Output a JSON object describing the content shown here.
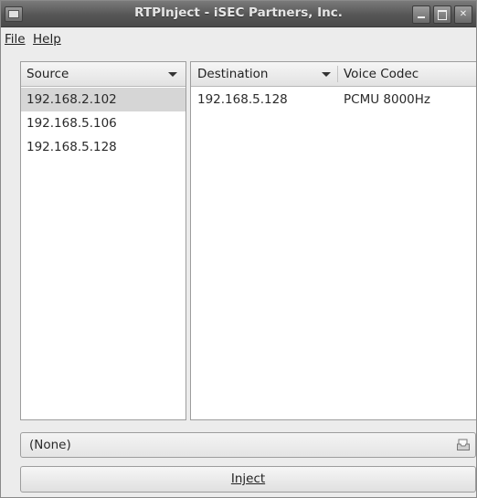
{
  "window": {
    "title": "RTPInject - iSEC Partners, Inc."
  },
  "menu": {
    "file": "File",
    "help": "Help"
  },
  "sources": {
    "header": "Source",
    "items": [
      "192.168.2.102",
      "192.168.5.106",
      "192.168.5.128"
    ],
    "selected_index": 0
  },
  "destinations": {
    "headers": {
      "destination": "Destination",
      "codec": "Voice Codec"
    },
    "rows": [
      {
        "destination": "192.168.5.128",
        "codec": "PCMU 8000Hz"
      }
    ]
  },
  "file_chooser": {
    "value": "(None)",
    "icon": "document-open-icon"
  },
  "inject_button": {
    "label": "Inject"
  }
}
